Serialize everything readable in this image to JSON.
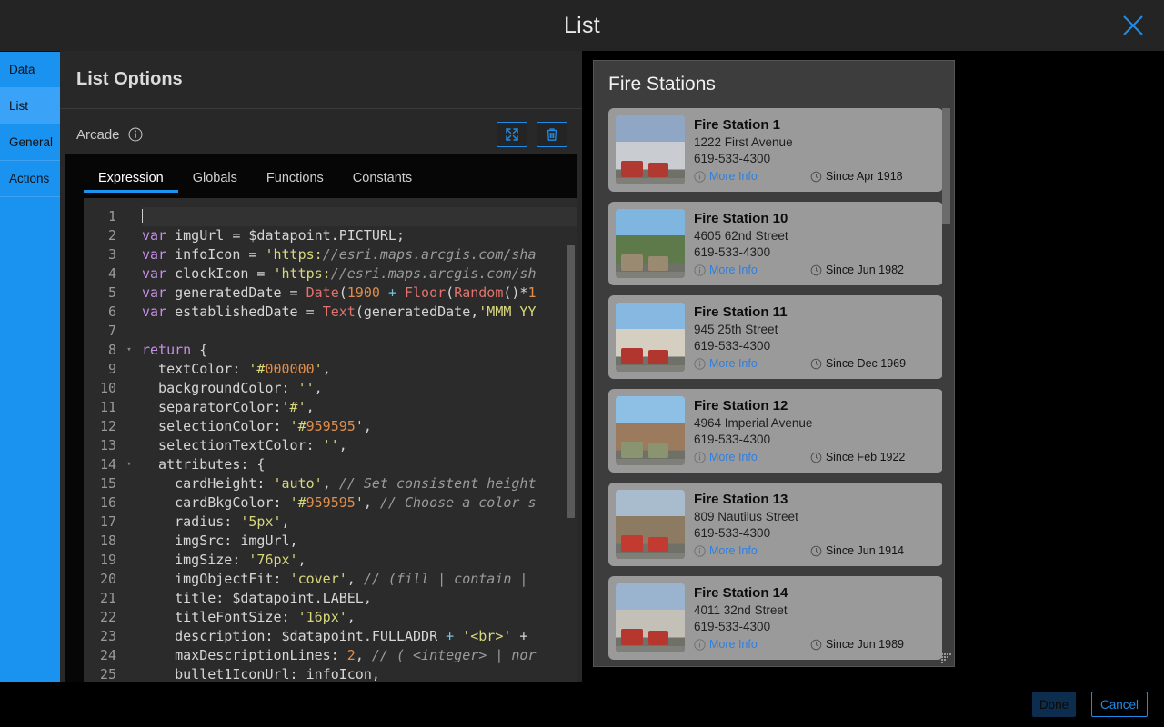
{
  "window": {
    "title": "List",
    "close_icon": "close-icon"
  },
  "rail": {
    "items": [
      {
        "label": "Data",
        "active": false
      },
      {
        "label": "List",
        "active": true
      },
      {
        "label": "General",
        "active": false
      },
      {
        "label": "Actions",
        "active": false
      }
    ]
  },
  "options": {
    "title": "List Options",
    "arcade_label": "Arcade",
    "info_icon": "info-icon",
    "expand_button": {
      "icon": "expand-icon",
      "label": "Expand"
    },
    "delete_button": {
      "icon": "trash-icon",
      "label": "Delete"
    },
    "tabs": [
      {
        "label": "Expression",
        "active": true
      },
      {
        "label": "Globals",
        "active": false
      },
      {
        "label": "Functions",
        "active": false
      },
      {
        "label": "Constants",
        "active": false
      }
    ]
  },
  "editor": {
    "language": "Arcade",
    "first_line": 1,
    "last_line": 25,
    "lines": [
      {
        "n": 1,
        "fold": "",
        "text": ""
      },
      {
        "n": 2,
        "fold": "",
        "text": "var imgUrl = $datapoint.PICTURL;"
      },
      {
        "n": 3,
        "fold": "",
        "text": "var infoIcon = 'https://esri.maps.arcgis.com/sha"
      },
      {
        "n": 4,
        "fold": "",
        "text": "var clockIcon = 'https://esri.maps.arcgis.com/sh"
      },
      {
        "n": 5,
        "fold": "",
        "text": "var generatedDate = Date(1900 + Floor(Random()*1"
      },
      {
        "n": 6,
        "fold": "",
        "text": "var establishedDate = Text(generatedDate,'MMM YY"
      },
      {
        "n": 7,
        "fold": "",
        "text": ""
      },
      {
        "n": 8,
        "fold": "▾",
        "text": "return {"
      },
      {
        "n": 9,
        "fold": "",
        "text": "  textColor: '#000000',"
      },
      {
        "n": 10,
        "fold": "",
        "text": "  backgroundColor: '',"
      },
      {
        "n": 11,
        "fold": "",
        "text": "  separatorColor:'#',"
      },
      {
        "n": 12,
        "fold": "",
        "text": "  selectionColor: '#959595',"
      },
      {
        "n": 13,
        "fold": "",
        "text": "  selectionTextColor: '',"
      },
      {
        "n": 14,
        "fold": "▾",
        "text": "  attributes: {"
      },
      {
        "n": 15,
        "fold": "",
        "text": "    cardHeight: 'auto', // Set consistent height"
      },
      {
        "n": 16,
        "fold": "",
        "text": "    cardBkgColor: '#959595', // Choose a color s"
      },
      {
        "n": 17,
        "fold": "",
        "text": "    radius: '5px',"
      },
      {
        "n": 18,
        "fold": "",
        "text": "    imgSrc: imgUrl,"
      },
      {
        "n": 19,
        "fold": "",
        "text": "    imgSize: '76px',"
      },
      {
        "n": 20,
        "fold": "",
        "text": "    imgObjectFit: 'cover', // (fill | contain |"
      },
      {
        "n": 21,
        "fold": "",
        "text": "    title: $datapoint.LABEL,"
      },
      {
        "n": 22,
        "fold": "",
        "text": "    titleFontSize: '16px',"
      },
      {
        "n": 23,
        "fold": "",
        "text": "    description: $datapoint.FULLADDR + '<br>' +"
      },
      {
        "n": 24,
        "fold": "",
        "text": "    maxDescriptionLines: 2, // ( <integer> | nor"
      },
      {
        "n": 25,
        "fold": "",
        "text": "    bullet1IconUrl: infoIcon,"
      }
    ]
  },
  "preview": {
    "title": "Fire Stations",
    "cards": [
      {
        "name": "Fire Station 1",
        "address": "1222 First Avenue",
        "phone": "619-533-4300",
        "more_info": "More Info",
        "since": "Since Apr 1918",
        "info_icon": "info-circle-icon",
        "clock_icon": "clock-icon",
        "thumb": "fire-station-1-photo"
      },
      {
        "name": "Fire Station 10",
        "address": "4605 62nd Street",
        "phone": "619-533-4300",
        "more_info": "More Info",
        "since": "Since Jun 1982",
        "info_icon": "info-circle-icon",
        "clock_icon": "clock-icon",
        "thumb": "fire-station-10-photo"
      },
      {
        "name": "Fire Station 11",
        "address": "945 25th Street",
        "phone": "619-533-4300",
        "more_info": "More Info",
        "since": "Since Dec 1969",
        "info_icon": "info-circle-icon",
        "clock_icon": "clock-icon",
        "thumb": "fire-station-11-photo"
      },
      {
        "name": "Fire Station 12",
        "address": "4964 Imperial Avenue",
        "phone": "619-533-4300",
        "more_info": "More Info",
        "since": "Since Feb 1922",
        "info_icon": "info-circle-icon",
        "clock_icon": "clock-icon",
        "thumb": "fire-station-12-photo"
      },
      {
        "name": "Fire Station 13",
        "address": "809 Nautilus Street",
        "phone": "619-533-4300",
        "more_info": "More Info",
        "since": "Since Jun 1914",
        "info_icon": "info-circle-icon",
        "clock_icon": "clock-icon",
        "thumb": "fire-station-13-photo"
      },
      {
        "name": "Fire Station 14",
        "address": "4011 32nd Street",
        "phone": "619-533-4300",
        "more_info": "More Info",
        "since": "Since Jun 1989",
        "info_icon": "info-circle-icon",
        "clock_icon": "clock-icon",
        "thumb": "fire-station-14-photo"
      }
    ]
  },
  "footer": {
    "done_label": "Done",
    "cancel_label": "Cancel"
  },
  "colors": {
    "accent_blue": "#1a93f0",
    "rail_active": "#3aa3f7",
    "panel_dark": "#282828",
    "editor_bg": "#2b2b2b",
    "preview_bg": "#3d3d3d",
    "card_bg": "#9a9a9a",
    "link_blue": "#2f7fe0"
  }
}
